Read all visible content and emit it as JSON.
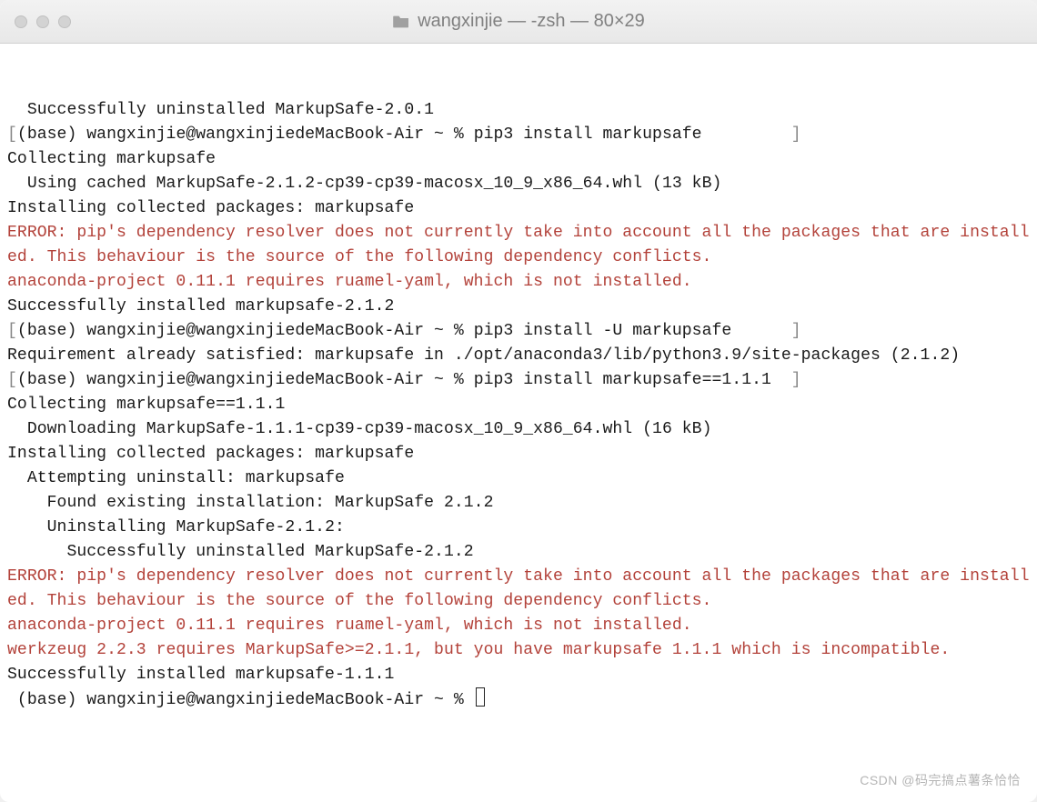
{
  "window": {
    "title": "wangxinjie — -zsh — 80×29"
  },
  "prompt": {
    "user": "wangxinjie",
    "host": "wangxinjiedeMacBook-Air",
    "env": "(base)",
    "cwd": "~",
    "symbol": "%"
  },
  "lines": [
    {
      "type": "out",
      "text": "  Successfully uninstalled MarkupSafe-2.0.1"
    },
    {
      "type": "cmd",
      "text": "pip3 install markupsafe"
    },
    {
      "type": "out",
      "text": "Collecting markupsafe"
    },
    {
      "type": "out",
      "text": "  Using cached MarkupSafe-2.1.2-cp39-cp39-macosx_10_9_x86_64.whl (13 kB)"
    },
    {
      "type": "out",
      "text": "Installing collected packages: markupsafe"
    },
    {
      "type": "err",
      "text": "ERROR: pip's dependency resolver does not currently take into account all the packages that are installed. This behaviour is the source of the following dependency conflicts."
    },
    {
      "type": "err",
      "text": "anaconda-project 0.11.1 requires ruamel-yaml, which is not installed."
    },
    {
      "type": "out",
      "text": "Successfully installed markupsafe-2.1.2"
    },
    {
      "type": "cmd",
      "text": "pip3 install -U markupsafe"
    },
    {
      "type": "out",
      "text": "Requirement already satisfied: markupsafe in ./opt/anaconda3/lib/python3.9/site-packages (2.1.2)"
    },
    {
      "type": "cmd",
      "text": "pip3 install markupsafe==1.1.1"
    },
    {
      "type": "out",
      "text": "Collecting markupsafe==1.1.1"
    },
    {
      "type": "out",
      "text": "  Downloading MarkupSafe-1.1.1-cp39-cp39-macosx_10_9_x86_64.whl (16 kB)"
    },
    {
      "type": "out",
      "text": "Installing collected packages: markupsafe"
    },
    {
      "type": "out",
      "text": "  Attempting uninstall: markupsafe"
    },
    {
      "type": "out",
      "text": "    Found existing installation: MarkupSafe 2.1.2"
    },
    {
      "type": "out",
      "text": "    Uninstalling MarkupSafe-2.1.2:"
    },
    {
      "type": "out",
      "text": "      Successfully uninstalled MarkupSafe-2.1.2"
    },
    {
      "type": "err",
      "text": "ERROR: pip's dependency resolver does not currently take into account all the packages that are installed. This behaviour is the source of the following dependency conflicts."
    },
    {
      "type": "err",
      "text": "anaconda-project 0.11.1 requires ruamel-yaml, which is not installed."
    },
    {
      "type": "err",
      "text": "werkzeug 2.2.3 requires MarkupSafe>=2.1.1, but you have markupsafe 1.1.1 which is incompatible."
    },
    {
      "type": "out",
      "text": "Successfully installed markupsafe-1.1.1"
    },
    {
      "type": "cmd",
      "text": "",
      "cursor": true,
      "nobracket": true
    }
  ],
  "watermark": "CSDN @码完搞点薯条恰恰"
}
